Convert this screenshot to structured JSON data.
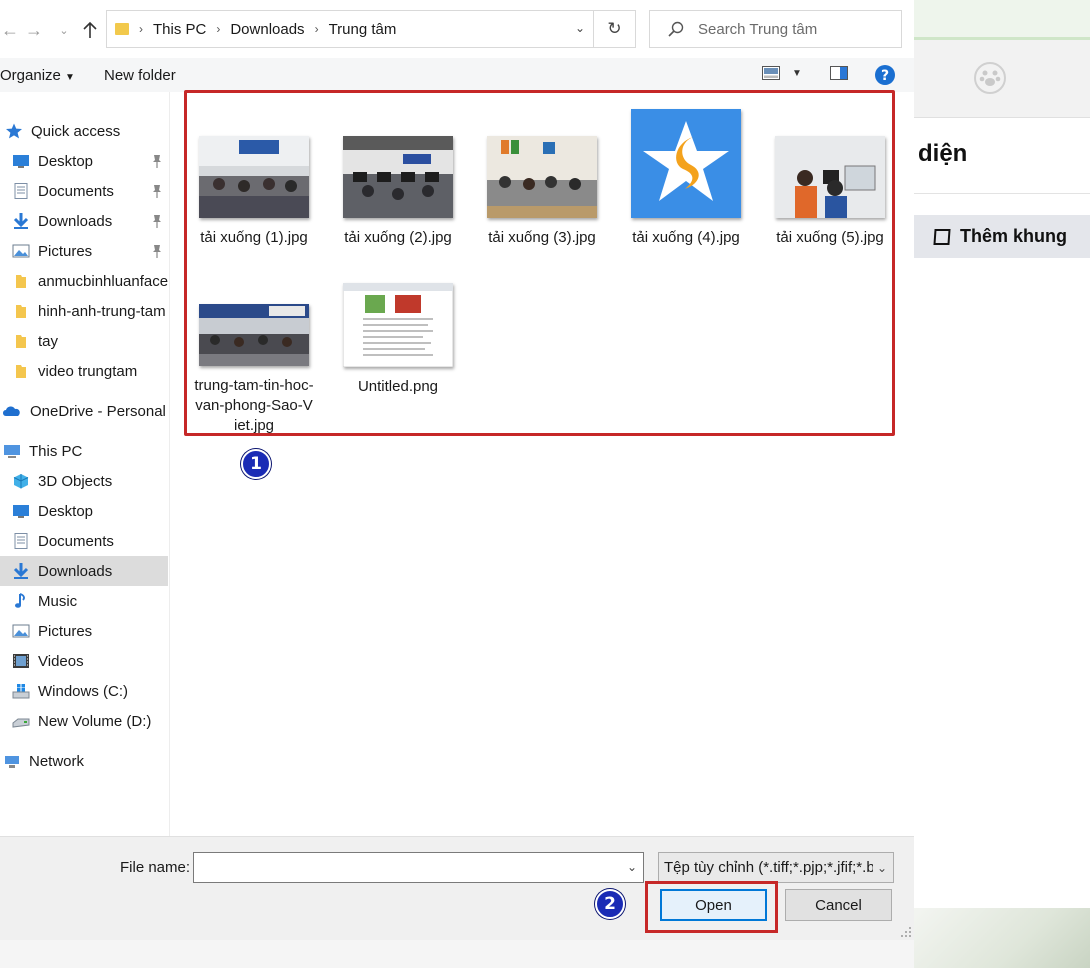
{
  "nav": {
    "breadcrumbs": [
      "This PC",
      "Downloads",
      "Trung tâm"
    ],
    "search_placeholder": "Search Trung tâm"
  },
  "toolbar": {
    "organize": "Organize",
    "new_folder": "New folder"
  },
  "sidebar": {
    "quick_access": "Quick access",
    "quick_items": [
      {
        "label": "Desktop",
        "icon": "desktop-icon",
        "pinned": true
      },
      {
        "label": "Documents",
        "icon": "documents-icon",
        "pinned": true
      },
      {
        "label": "Downloads",
        "icon": "downloads-icon",
        "pinned": true
      },
      {
        "label": "Pictures",
        "icon": "pictures-icon",
        "pinned": true
      },
      {
        "label": "anmucbinhluanface",
        "icon": "folder-icon",
        "pinned": false
      },
      {
        "label": "hinh-anh-trung-tam",
        "icon": "folder-icon",
        "pinned": false
      },
      {
        "label": "tay",
        "icon": "folder-icon",
        "pinned": false
      },
      {
        "label": "video trungtam",
        "icon": "folder-icon",
        "pinned": false
      }
    ],
    "onedrive": "OneDrive - Personal",
    "this_pc": "This PC",
    "pc_items": [
      {
        "label": "3D Objects",
        "icon": "3d-objects-icon"
      },
      {
        "label": "Desktop",
        "icon": "desktop-icon"
      },
      {
        "label": "Documents",
        "icon": "documents-icon"
      },
      {
        "label": "Downloads",
        "icon": "downloads-icon",
        "selected": true
      },
      {
        "label": "Music",
        "icon": "music-icon"
      },
      {
        "label": "Pictures",
        "icon": "pictures-icon"
      },
      {
        "label": "Videos",
        "icon": "videos-icon"
      },
      {
        "label": "Windows (C:)",
        "icon": "drive-c-icon"
      },
      {
        "label": "New Volume (D:)",
        "icon": "drive-d-icon"
      }
    ],
    "network": "Network"
  },
  "files": [
    {
      "name": "tải xuống (1).jpg"
    },
    {
      "name": "tải xuống (2).jpg"
    },
    {
      "name": "tải xuống (3).jpg"
    },
    {
      "name": "tải xuống (4).jpg"
    },
    {
      "name": "tải xuống (5).jpg"
    },
    {
      "name": "trung-tam-tin-hoc-van-phong-Sao-Viet.jpg"
    },
    {
      "name": "Untitled.png"
    }
  ],
  "annotations": {
    "badge1": "1",
    "badge2": "2",
    "highlight_color": "#c62828",
    "badge_color": "#1a2bb5"
  },
  "footer": {
    "file_name_label": "File name:",
    "file_name_value": "",
    "file_type": "Tệp tùy chỉnh (*.tiff;*.pjp;*.jfif;*.b",
    "open": "Open",
    "cancel": "Cancel"
  },
  "background_app": {
    "title": "diện",
    "frame_button": "Thêm khung"
  }
}
